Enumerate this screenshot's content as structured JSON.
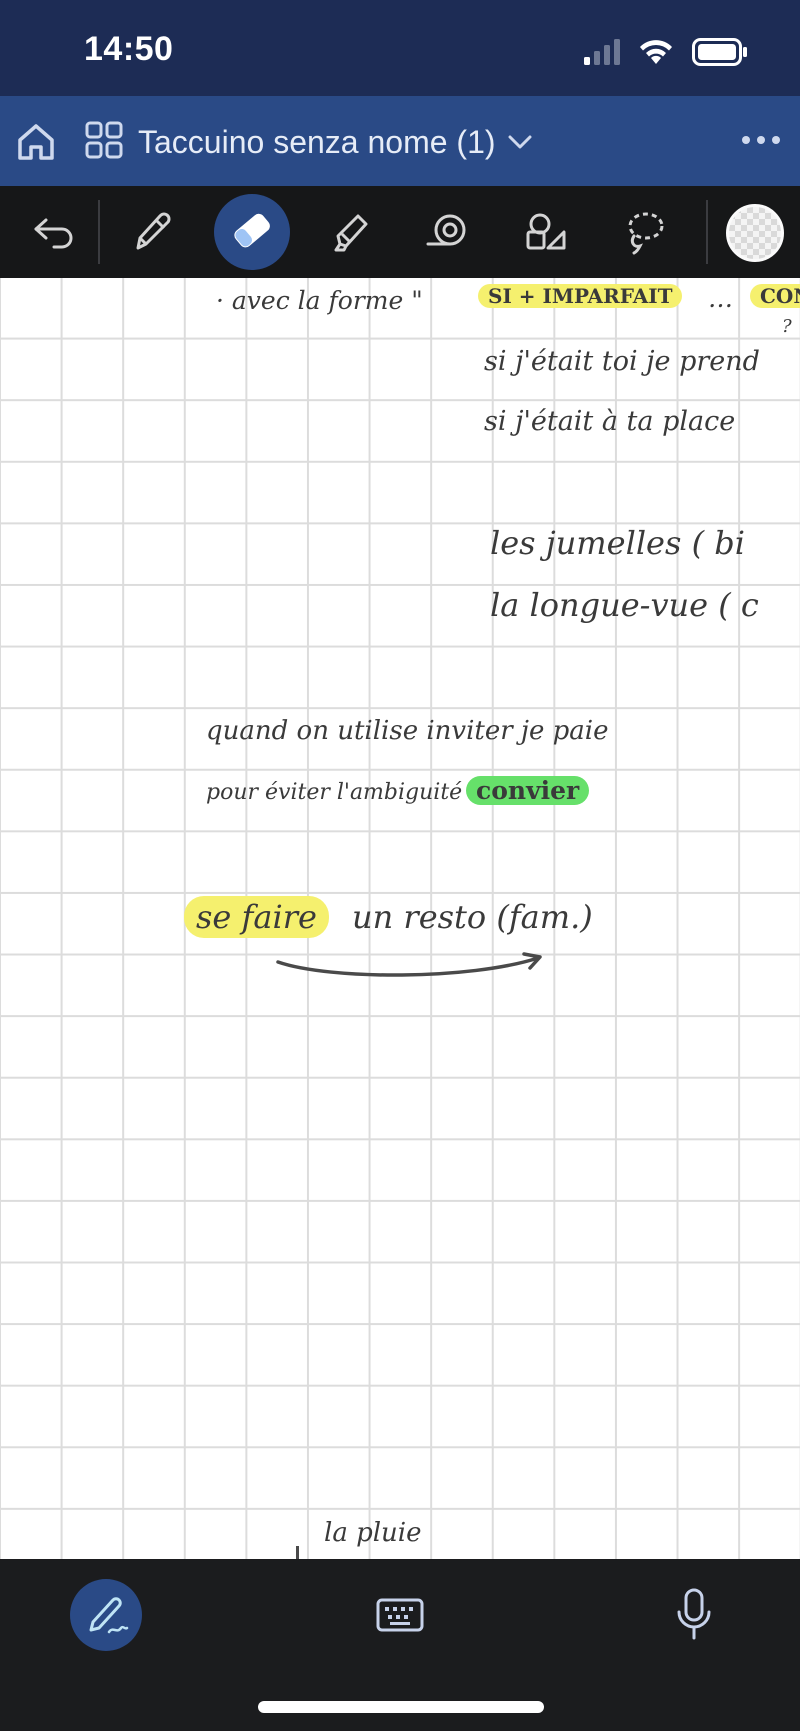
{
  "status_bar": {
    "time": "14:50"
  },
  "header": {
    "title": "Taccuino senza nome (1)"
  },
  "canvas": {
    "notes": [
      {
        "id": "line1a",
        "text": "·  avec  la  forme  \""
      },
      {
        "id": "line1b",
        "text": "SI + IMPARFAIT"
      },
      {
        "id": "line1c",
        "text": "…"
      },
      {
        "id": "line1d",
        "text": "CON"
      },
      {
        "id": "line1e",
        "text": "?"
      },
      {
        "id": "line2",
        "text": "si j'était toi  je  prend"
      },
      {
        "id": "line3",
        "text": "si j'était à ta place"
      },
      {
        "id": "line4",
        "text": "les  jumelles    ( bi"
      },
      {
        "id": "line5",
        "text": "la  longue-vue  ( c"
      },
      {
        "id": "line6",
        "text": "quand  on  utilise  inviter     je  paie"
      },
      {
        "id": "line7a",
        "text": "pour éviter l'ambiguité"
      },
      {
        "id": "line7b",
        "text": "convier"
      },
      {
        "id": "line8a",
        "text": "se  faire"
      },
      {
        "id": "line8b",
        "text": "un  resto  (fam.)"
      },
      {
        "id": "line9",
        "text": "la  pluie"
      }
    ]
  },
  "colors": {
    "status_bg": "#1d2c55",
    "header_bg": "#2a4a86",
    "toolbar_bg": "#161718",
    "highlight_yellow": "#f5f06e",
    "highlight_green": "#66e06a"
  },
  "icons": {
    "toolbar": [
      "undo-icon",
      "pen-icon",
      "eraser-icon",
      "highlighter-icon",
      "tape-icon",
      "shapes-icon",
      "lasso-icon",
      "color-swatch"
    ],
    "bottom": [
      "pencil-mode-icon",
      "keyboard-icon",
      "microphone-icon"
    ]
  }
}
